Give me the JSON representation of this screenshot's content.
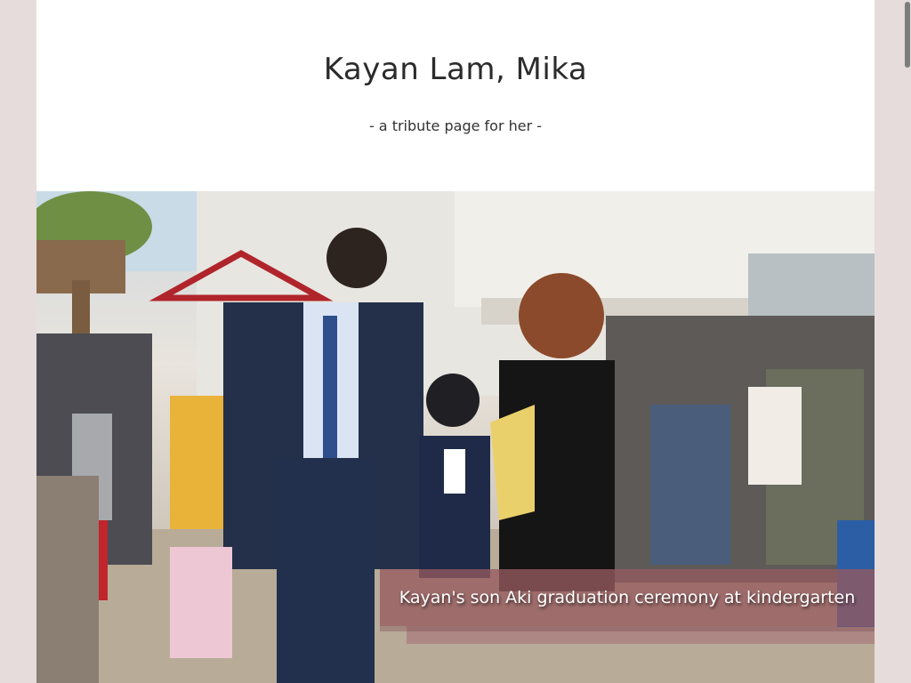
{
  "header": {
    "title": "Kayan Lam, Mika",
    "subtitle": "- a tribute page for her -"
  },
  "image": {
    "caption": "Kayan's son Aki graduation ceremony at kindergarten"
  },
  "colors": {
    "background": "#e6dcdc",
    "caption_overlay": "#965a5f",
    "text": "#2b2b2b"
  }
}
